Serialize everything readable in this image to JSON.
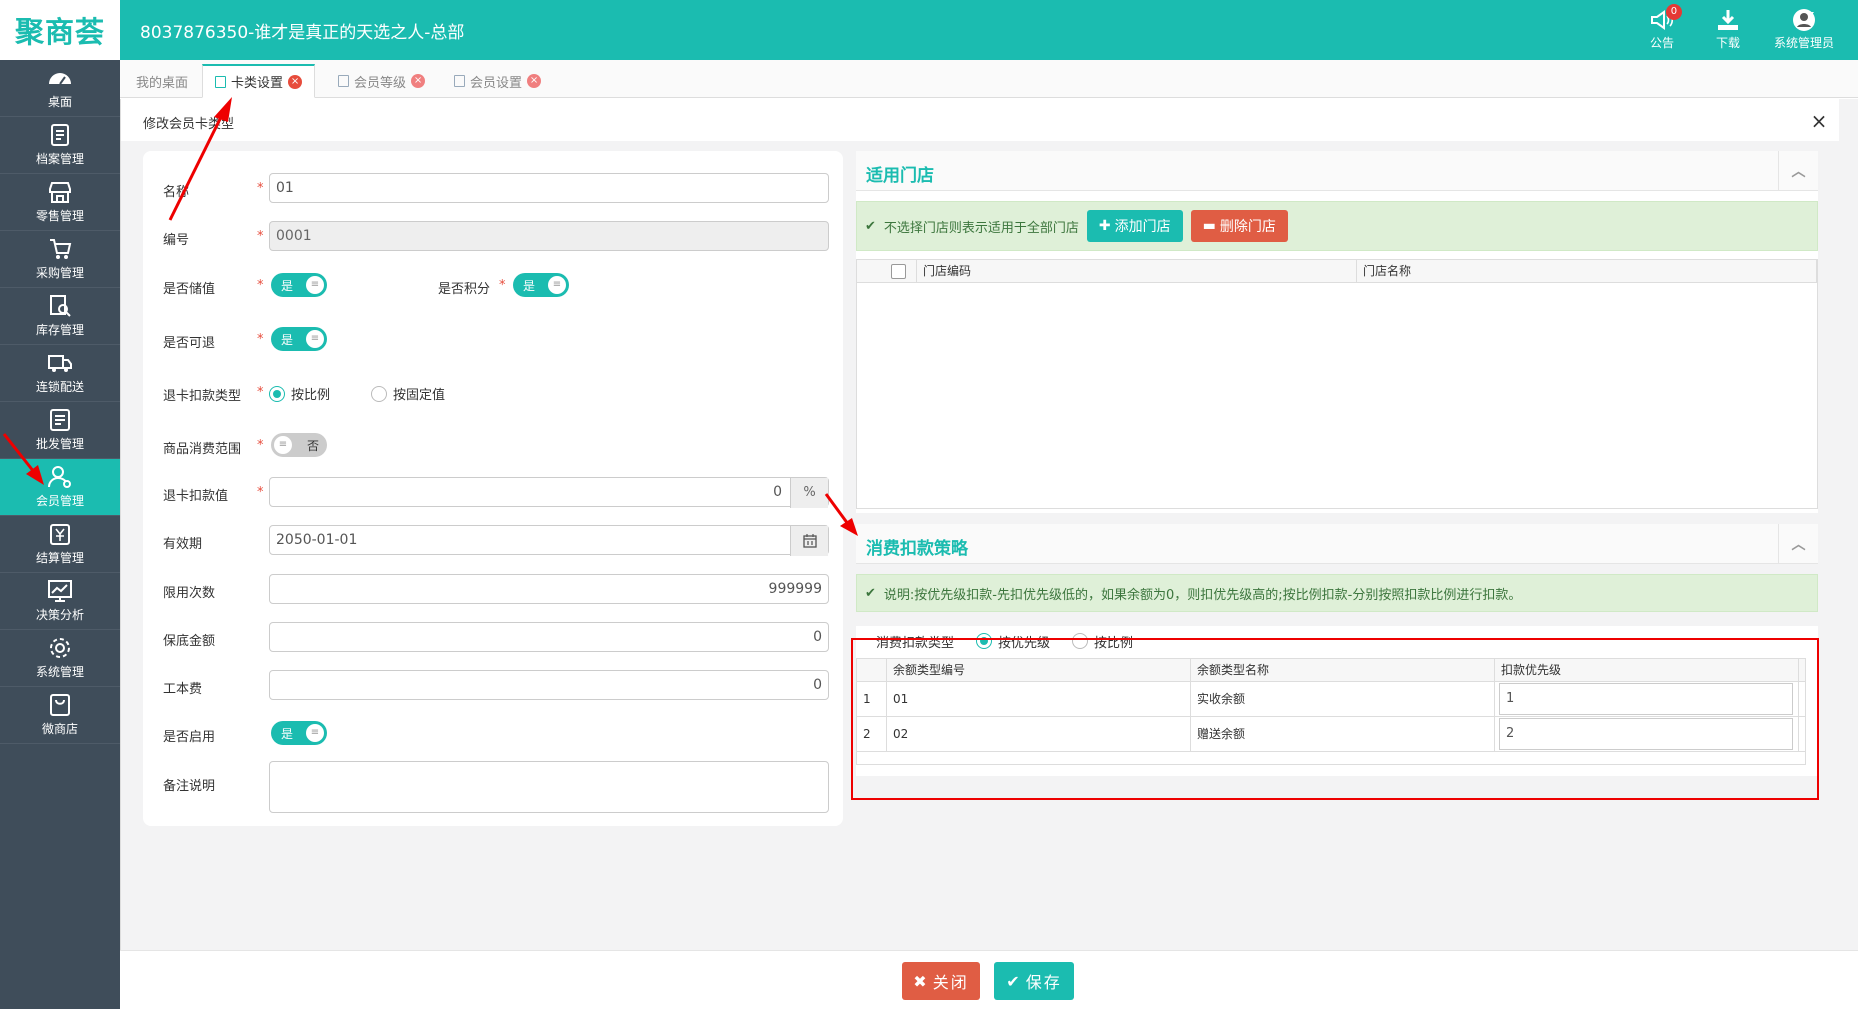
{
  "app": {
    "logo_text": "聚商荟",
    "title": "8037876350-谁才是真正的天选之人-总部",
    "top_icons": [
      {
        "icon": "speaker-icon",
        "label": "公告",
        "badge": "0"
      },
      {
        "icon": "download-icon",
        "label": "下载"
      },
      {
        "icon": "user-avatar-icon",
        "label": "系统管理员"
      }
    ]
  },
  "sidebar": {
    "items": [
      {
        "icon": "dashboard-icon",
        "label": "桌面"
      },
      {
        "icon": "archive-icon",
        "label": "档案管理"
      },
      {
        "icon": "store-icon",
        "label": "零售管理"
      },
      {
        "icon": "purchase-icon",
        "label": "采购管理"
      },
      {
        "icon": "inventory-icon",
        "label": "库存管理"
      },
      {
        "icon": "truck-icon",
        "label": "连锁配送"
      },
      {
        "icon": "wholesale-icon",
        "label": "批发管理"
      },
      {
        "icon": "member-icon",
        "label": "会员管理",
        "active": true
      },
      {
        "icon": "settlement-icon",
        "label": "结算管理"
      },
      {
        "icon": "chart-icon",
        "label": "决策分析"
      },
      {
        "icon": "gear-icon",
        "label": "系统管理"
      },
      {
        "icon": "shop-bag-icon",
        "label": "微商店"
      }
    ]
  },
  "tabs": [
    {
      "label": "我的桌面",
      "closable": false
    },
    {
      "label": "卡类设置",
      "active": true,
      "closable": true
    },
    {
      "label": "会员等级",
      "closable": true
    },
    {
      "label": "会员设置",
      "closable": true
    }
  ],
  "page": {
    "title": "修改会员卡类型",
    "close": "×"
  },
  "form": {
    "name_label": "名称",
    "name_value": "01",
    "code_label": "编号",
    "code_value": "0001",
    "stored_value_label": "是否储值",
    "stored_value_toggle": "是",
    "points_label": "是否积分",
    "points_toggle": "是",
    "refundable_label": "是否可退",
    "refundable_toggle": "是",
    "refund_deduct_type_label": "退卡扣款类型",
    "refund_deduct_options": [
      "按比例",
      "按固定值"
    ],
    "refund_deduct_selected": "按比例",
    "consume_scope_label": "商品消费范围",
    "consume_scope_toggle": "否",
    "refund_deduct_value_label": "退卡扣款值",
    "refund_deduct_value": "0",
    "refund_deduct_unit": "%",
    "expiry_label": "有效期",
    "expiry_value": "2050-01-01",
    "limit_count_label": "限用次数",
    "limit_count_value": "999999",
    "min_amount_label": "保底金额",
    "min_amount_value": "0",
    "card_fee_label": "工本费",
    "card_fee_value": "0",
    "enabled_label": "是否启用",
    "enabled_toggle": "是",
    "remark_label": "备注说明",
    "remark_value": "",
    "required_mark": "*"
  },
  "stores_section": {
    "title": "适用门店",
    "notice": "不选择门店则表示适用于全部门店",
    "add_button": "添加门店",
    "delete_button": "删除门店",
    "columns": [
      "门店编码",
      "门店名称"
    ],
    "rows": []
  },
  "deduct_section": {
    "title": "消费扣款策略",
    "notice": "说明:按优先级扣款-先扣优先级低的，如果余额为0，则扣优先级高的;按比例扣款-分别按照扣款比例进行扣款。",
    "type_label": "消费扣款类型",
    "type_options": [
      "按优先级",
      "按比例"
    ],
    "type_selected": "按优先级",
    "columns": [
      "余额类型编号",
      "余额类型名称",
      "扣款优先级"
    ],
    "rows": [
      {
        "index": "1",
        "code": "01",
        "name": "实收余额",
        "priority": "1"
      },
      {
        "index": "2",
        "code": "02",
        "name": "赠送余额",
        "priority": "2"
      }
    ]
  },
  "footer": {
    "close_button": "关闭",
    "save_button": "保存"
  },
  "colors": {
    "brand": "#1bbcb0",
    "sidebar": "#3f4d5a",
    "danger": "#e05d44",
    "annotation": "#ee0000"
  }
}
